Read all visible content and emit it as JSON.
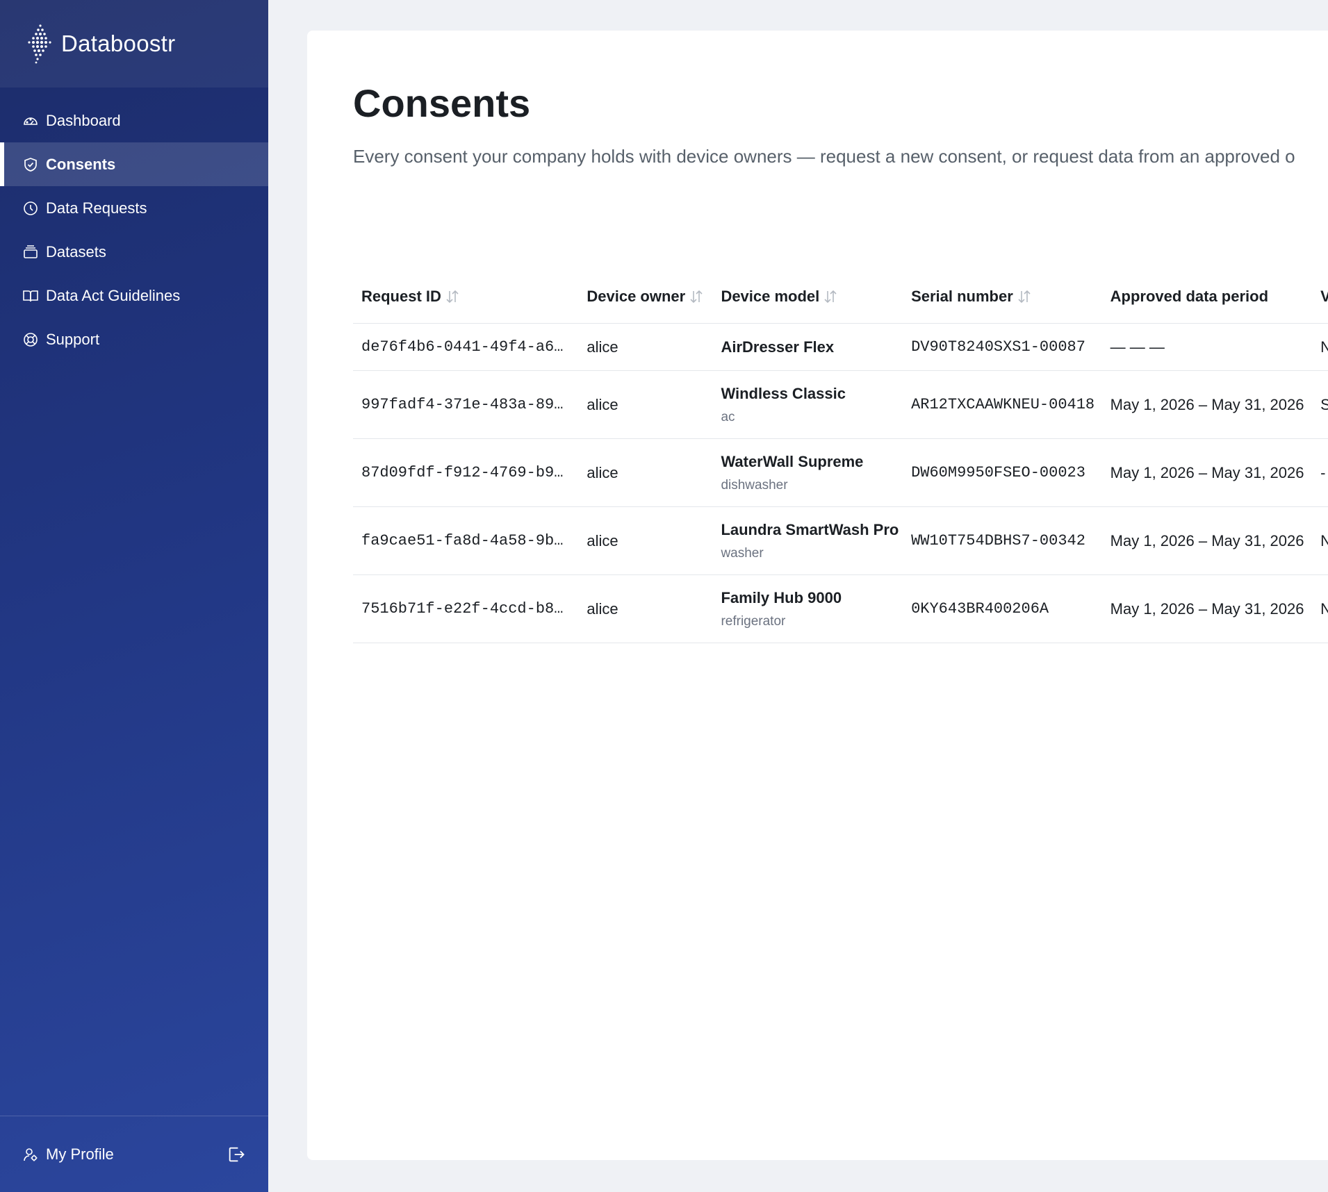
{
  "brand": {
    "name": "Databoostr"
  },
  "nav": [
    {
      "label": "Dashboard",
      "icon": "gauge-icon",
      "active": false
    },
    {
      "label": "Consents",
      "icon": "shield-check-icon",
      "active": true
    },
    {
      "label": "Data Requests",
      "icon": "clock-icon",
      "active": false
    },
    {
      "label": "Datasets",
      "icon": "stack-icon",
      "active": false
    },
    {
      "label": "Data Act Guidelines",
      "icon": "book-icon",
      "active": false
    },
    {
      "label": "Support",
      "icon": "lifebuoy-icon",
      "active": false
    }
  ],
  "profile": {
    "label": "My Profile",
    "icon": "user-icon",
    "logout_icon": "logout-icon"
  },
  "page": {
    "title": "Consents",
    "subtitle": "Every consent your company holds with device owners — request a new consent, or request data from an approved o"
  },
  "table": {
    "headers": [
      "Request ID",
      "Device owner",
      "Device model",
      "Serial number",
      "Approved data period",
      "V"
    ],
    "rows": [
      {
        "request_id": "de76f4b6-0441-49f4-a6…",
        "owner": "alice",
        "model": "AirDresser Flex",
        "type": "",
        "serial": "DV90T8240SXS1-00087",
        "period": "— — —",
        "extra": "N"
      },
      {
        "request_id": "997fadf4-371e-483a-89…",
        "owner": "alice",
        "model": "Windless Classic",
        "type": "ac",
        "serial": "AR12TXCAAWKNEU-00418",
        "period": "May 1, 2026 – May 31, 2026",
        "extra": "S"
      },
      {
        "request_id": "87d09fdf-f912-4769-b9…",
        "owner": "alice",
        "model": "WaterWall Supreme",
        "type": "dishwasher",
        "serial": "DW60M9950FSEO-00023",
        "period": "May 1, 2026 – May 31, 2026",
        "extra": "-"
      },
      {
        "request_id": "fa9cae51-fa8d-4a58-9b…",
        "owner": "alice",
        "model": "Laundra SmartWash Pro",
        "type": "washer",
        "serial": "WW10T754DBHS7-00342",
        "period": "May 1, 2026 – May 31, 2026",
        "extra": "N"
      },
      {
        "request_id": "7516b71f-e22f-4ccd-b8…",
        "owner": "alice",
        "model": "Family Hub 9000",
        "type": "refrigerator",
        "serial": "0KY643BR400206A",
        "period": "May 1, 2026 – May 31, 2026",
        "extra": "N"
      }
    ]
  }
}
